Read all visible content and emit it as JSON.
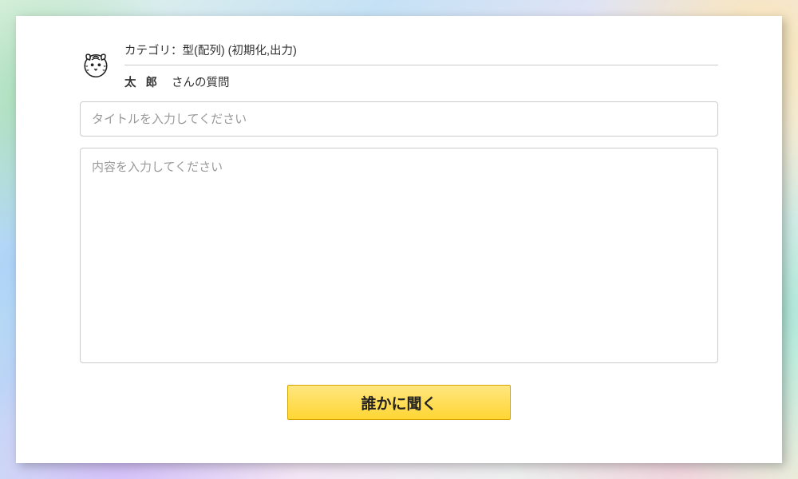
{
  "header": {
    "category_label": "カテゴリ：型(配列) (初期化,出力)",
    "author_name": "太 郎",
    "author_suffix": "さんの質問"
  },
  "form": {
    "title_placeholder": "タイトルを入力してください",
    "title_value": "",
    "content_placeholder": "内容を入力してください",
    "content_value": ""
  },
  "actions": {
    "ask_label": "誰かに聞く"
  }
}
